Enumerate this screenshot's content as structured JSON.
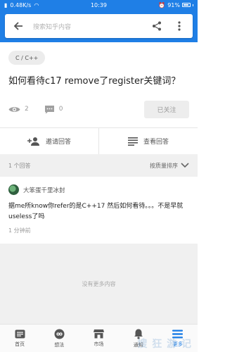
{
  "status_bar": {
    "speed": "0.48K/s",
    "time": "10:39",
    "battery": "91%"
  },
  "search": {
    "placeholder": "搜索知乎内容"
  },
  "topic": {
    "label": "C / C++"
  },
  "question": {
    "title": "如何看待c17 remove了register关键词？",
    "views": "2",
    "comments": "0",
    "follow_label": "已关注"
  },
  "actions": {
    "invite": "邀请回答",
    "view_answers": "查看回答"
  },
  "answers_bar": {
    "count": "1 个回答",
    "sort": "按质量排序"
  },
  "answer": {
    "author": "大笨蛋千里冰封",
    "text": "据me所know你refer的是C++17 然后如何看待。。。不是早就useless了吗",
    "time": "1 分钟前"
  },
  "footer_note": "没有更多内容",
  "nav": {
    "items": [
      {
        "label": "首页",
        "icon": "home-icon"
      },
      {
        "label": "想法",
        "icon": "idea-icon"
      },
      {
        "label": "市场",
        "icon": "market-icon"
      },
      {
        "label": "通知",
        "icon": "bell-icon"
      },
      {
        "label": "更多",
        "icon": "menu-icon"
      }
    ]
  },
  "watermark": "搜 狂 游 记",
  "colors": {
    "primary": "#1f7fe6",
    "background": "#f0f0f0"
  }
}
